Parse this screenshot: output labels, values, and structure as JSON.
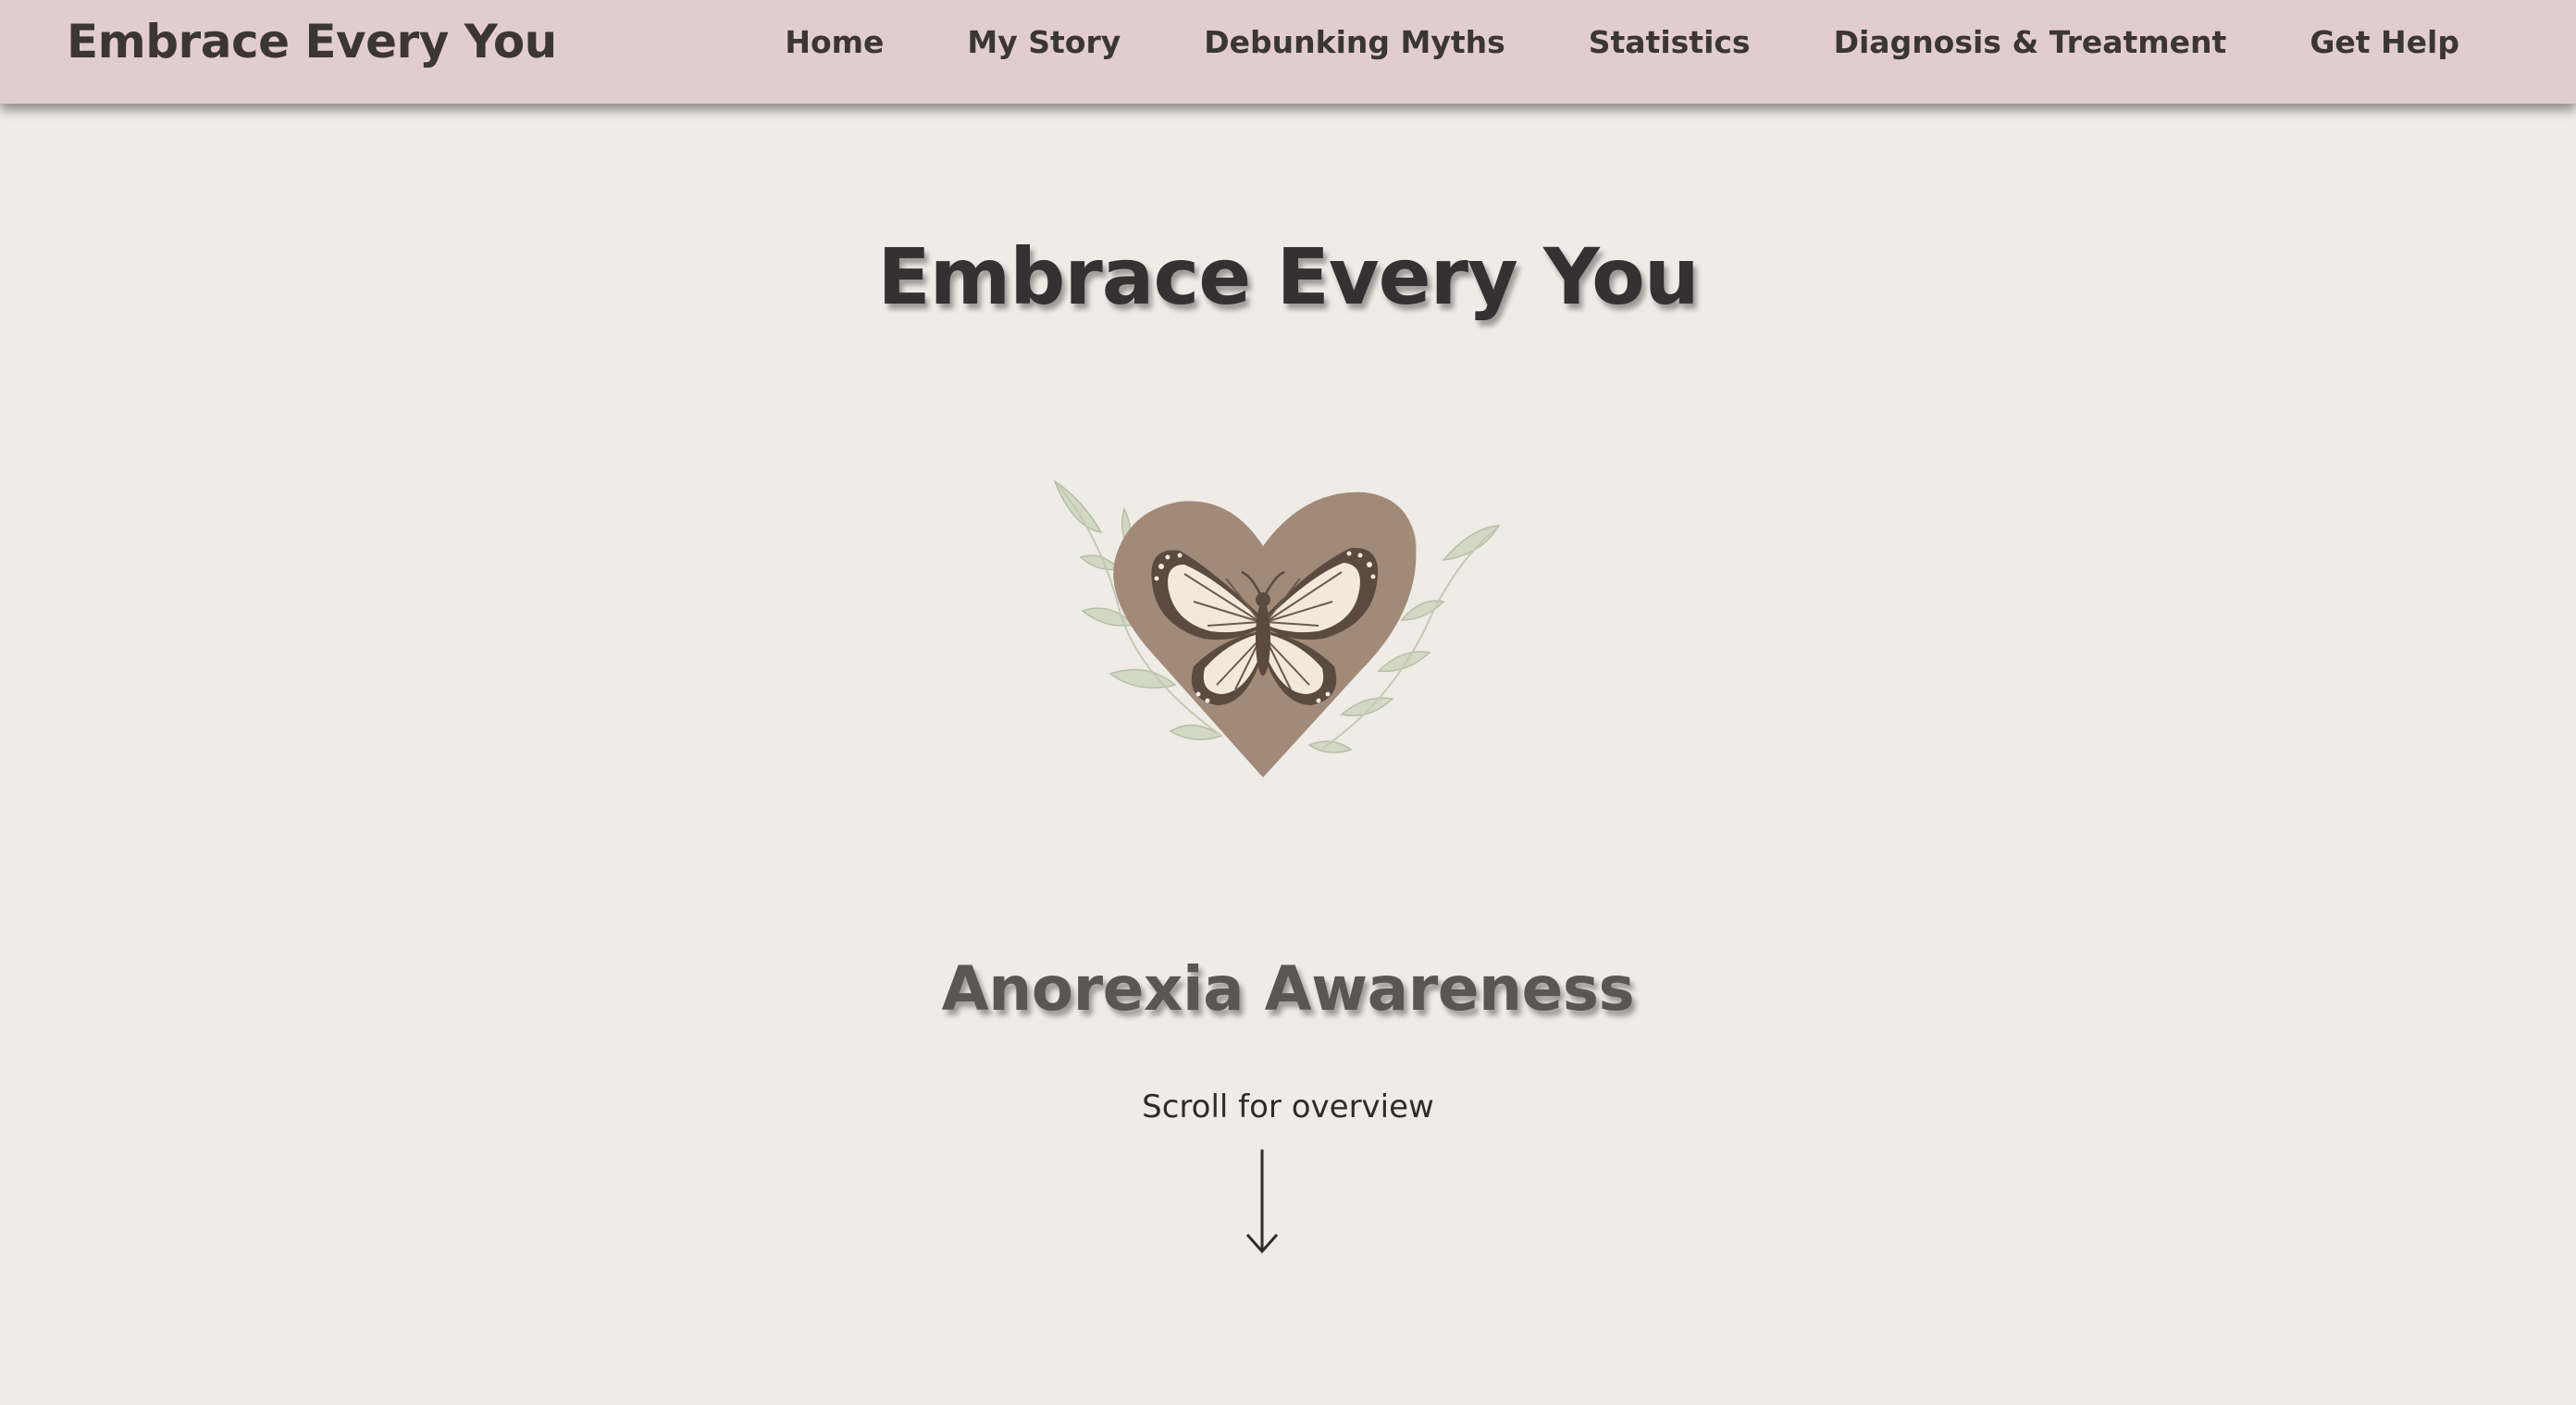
{
  "navbar": {
    "brand": "Embrace Every You",
    "links": [
      {
        "label": "Home"
      },
      {
        "label": "My Story"
      },
      {
        "label": "Debunking Myths"
      },
      {
        "label": "Statistics"
      },
      {
        "label": "Diagnosis & Treatment"
      },
      {
        "label": "Get Help"
      }
    ]
  },
  "hero": {
    "title": "Embrace Every You",
    "logo_icon": "heart-butterfly-logo",
    "subtitle": "Anorexia Awareness",
    "scroll_hint": "Scroll for overview",
    "scroll_icon": "arrow-down-icon"
  },
  "colors": {
    "navbar_bg": "#e2cdce",
    "page_bg": "#efebe6",
    "heart": "#a28a78",
    "butterfly_dark": "#5a4a40",
    "butterfly_light": "#f3e9d8",
    "leaves": "#d3d8c5"
  }
}
